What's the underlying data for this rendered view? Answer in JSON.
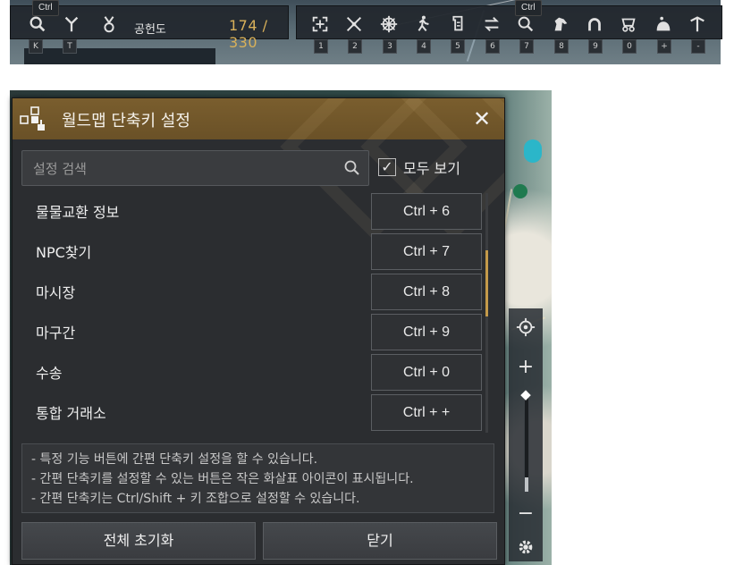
{
  "toolbar": {
    "ctrl_tip_left": "Ctrl",
    "ctrl_tip_right": "Ctrl",
    "map_label": "공헌도",
    "weight_text": "174 / 330",
    "left_icons": [
      {
        "name": "search-icon",
        "key": "K"
      },
      {
        "name": "pin-icon",
        "key": "T"
      }
    ],
    "right_icons": [
      {
        "name": "crosshair-expand-icon",
        "key": "1"
      },
      {
        "name": "crossed-tools-icon",
        "key": "2"
      },
      {
        "name": "ship-wheel-icon",
        "key": "3"
      },
      {
        "name": "running-man-icon",
        "key": "4"
      },
      {
        "name": "scroll-icon",
        "key": "5"
      },
      {
        "name": "exchange-arrows-icon",
        "key": "6"
      },
      {
        "name": "magnifier-icon",
        "key": "7"
      },
      {
        "name": "horse-icon",
        "key": "8"
      },
      {
        "name": "horseshoe-icon",
        "key": "9"
      },
      {
        "name": "carriage-icon",
        "key": "0"
      },
      {
        "name": "money-bag-icon",
        "key": "+"
      },
      {
        "name": "anchor-icon",
        "key": "-"
      }
    ]
  },
  "dialog": {
    "title": "월드맵 단축키 설정",
    "search_placeholder": "설정 검색",
    "show_all_label": "모두 보기",
    "show_all_checked": true,
    "scroll_position": 0.33,
    "rows": [
      {
        "label": "물물교환 정보",
        "key": "Ctrl + 6"
      },
      {
        "label": "NPC찾기",
        "key": "Ctrl + 7"
      },
      {
        "label": "마시장",
        "key": "Ctrl + 8"
      },
      {
        "label": "마구간",
        "key": "Ctrl + 9"
      },
      {
        "label": "수송",
        "key": "Ctrl + 0"
      },
      {
        "label": "통합 거래소",
        "key": "Ctrl + +"
      }
    ],
    "info_lines": [
      "- 특정 기능 버튼에 간편 단축키 설정을 할 수 있습니다.",
      "- 간편 단축키를 설정할 수 있는 버튼은 작은 화살표 아이콘이 표시됩니다.",
      "- 간편 단축키는 Ctrl/Shift + 키 조합으로 설정할 수 있습니다."
    ],
    "reset_label": "전체 초기화",
    "close_label": "닫기"
  },
  "map_controls": {
    "zoom_level": 0.15
  },
  "colors": {
    "header": "#6f5529",
    "accent": "#c49a4a",
    "weight": "#d9b15a"
  }
}
